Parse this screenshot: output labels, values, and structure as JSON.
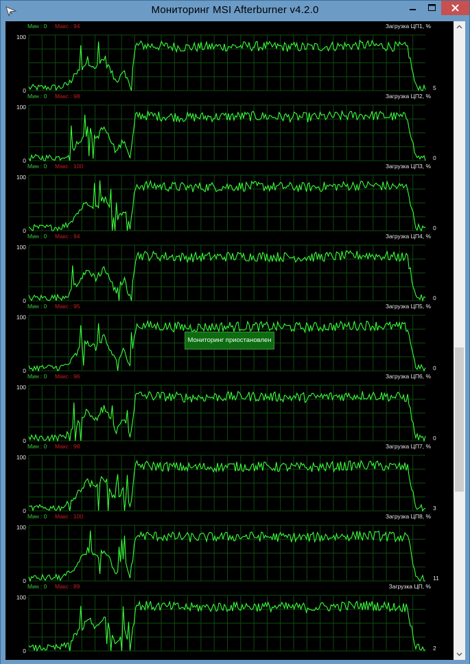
{
  "window": {
    "title": "Мониторинг MSI Afterburner v4.2.0",
    "icons": {
      "app": "afterburner-plane-icon",
      "minimize": "minimize-icon",
      "maximize": "maximize-icon",
      "close": "close-icon"
    }
  },
  "overlay": {
    "paused_label": "Мониторинг приостановлен"
  },
  "scrollbar": {
    "position_fraction": 0.5
  },
  "colors": {
    "background": "#000000",
    "grid": "#0f4a0f",
    "graph_line": "#3cff3c",
    "min_label": "#3cc83c",
    "max_label": "#c81e1e",
    "axis_text": "#e6e6e6",
    "title_text": "#e6e6e6"
  },
  "graphs": [
    {
      "name": "Загрузка ЦП1, %",
      "min_label": "Мин : 0",
      "max_label": "Макс : 94",
      "y_max": "100",
      "y_min": "0",
      "current": "5"
    },
    {
      "name": "Загрузка ЦП2, %",
      "min_label": "Мин : 0",
      "max_label": "Макс : 98",
      "y_max": "100",
      "y_min": "0",
      "current": "0"
    },
    {
      "name": "Загрузка ЦП3, %",
      "min_label": "Мин : 0",
      "max_label": "Макс : 100",
      "y_max": "100",
      "y_min": "0",
      "current": "0"
    },
    {
      "name": "Загрузка ЦП4, %",
      "min_label": "Мин : 0",
      "max_label": "Макс : 94",
      "y_max": "100",
      "y_min": "0",
      "current": "0"
    },
    {
      "name": "Загрузка ЦП5, %",
      "min_label": "Мин : 0",
      "max_label": "Макс : 95",
      "y_max": "100",
      "y_min": "0",
      "current": "0"
    },
    {
      "name": "Загрузка ЦП6, %",
      "min_label": "Мин : 0",
      "max_label": "Макс : 96",
      "y_max": "100",
      "y_min": "0",
      "current": "0"
    },
    {
      "name": "Загрузка ЦП7, %",
      "min_label": "Мин : 0",
      "max_label": "Макс : 98",
      "y_max": "100",
      "y_min": "0",
      "current": "3"
    },
    {
      "name": "Загрузка ЦП8, %",
      "min_label": "Мин : 0",
      "max_label": "Макс : 100",
      "y_max": "100",
      "y_min": "0",
      "current": "11"
    },
    {
      "name": "Загрузка ЦП, %",
      "min_label": "Мин : 0",
      "max_label": "Макс : 89",
      "y_max": "100",
      "y_min": "0",
      "current": "2"
    }
  ],
  "chart_data": {
    "type": "line",
    "series_template": [
      {
        "t": 0.0,
        "v": 5
      },
      {
        "t": 0.08,
        "v": 6
      },
      {
        "t": 0.1,
        "v": 12
      },
      {
        "t": 0.12,
        "v": 30
      },
      {
        "t": 0.15,
        "v": 55
      },
      {
        "t": 0.17,
        "v": 40
      },
      {
        "t": 0.19,
        "v": 60
      },
      {
        "t": 0.22,
        "v": 15
      },
      {
        "t": 0.24,
        "v": 40
      },
      {
        "t": 0.255,
        "v": 5
      },
      {
        "t": 0.27,
        "v": 82
      },
      {
        "t": 0.4,
        "v": 78
      },
      {
        "t": 0.55,
        "v": 80
      },
      {
        "t": 0.7,
        "v": 78
      },
      {
        "t": 0.85,
        "v": 82
      },
      {
        "t": 0.955,
        "v": 78
      },
      {
        "t": 0.975,
        "v": 8
      },
      {
        "t": 1.0,
        "v": 3
      }
    ],
    "ylim": [
      0,
      100
    ]
  }
}
